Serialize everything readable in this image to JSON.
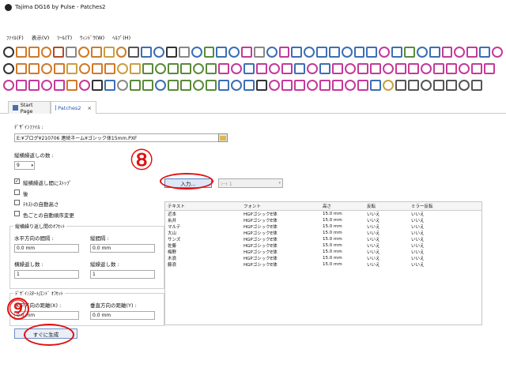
{
  "window": {
    "title": "Tajima DG16 by Pulse - Patches2"
  },
  "menu": [
    "ﾌｧｲﾙ(F)",
    "表示(V)",
    "ﾂｰﾙ(T)",
    "ｳｨﾝﾄﾞｳ(W)",
    "ﾍﾙﾌﾟ(H)"
  ],
  "tabs": [
    {
      "label": "Start Page"
    },
    {
      "label": "Patches2",
      "close": "×"
    }
  ],
  "form": {
    "design_file_label": "ﾃﾞｻﾞｲﾝﾌｧｲﾙ :",
    "design_file_path": "E:¥ブログ¥210706 連続ネーム¥ゴシック体15mm.PXF",
    "repeat_count_label": "縦横繰返しの数 :",
    "repeat_count_value": "9",
    "input_button": "入力...",
    "sheet_select": "ｼｰﾄ 1",
    "checkboxes": [
      {
        "label": "縦横繰返し間にｽﾄｯﾌﾟ",
        "checked": true,
        "mark": "✓"
      },
      {
        "label": "後",
        "checked": false,
        "mark": ""
      },
      {
        "label": "ﾃｷｽﾄの自動高さ",
        "checked": false,
        "mark": ""
      },
      {
        "label": "色ごとの自動順序変更",
        "checked": false,
        "mark": ""
      }
    ],
    "offset_group": {
      "title": "縦横繰り返し間のｵﾌｾｯﾄ",
      "h_spacing_label": "水平方向の間隔 :",
      "h_spacing_value": "0.0 mm",
      "v_spacing_label": "縦間隔 :",
      "v_spacing_value": "0.0 mm",
      "h_repeat_label": "横繰返し数 :",
      "h_repeat_value": "1",
      "v_repeat_label": "縦繰返し数 :",
      "v_repeat_value": "1"
    },
    "insert_group": {
      "title": "ﾃﾞｻﾞｲﾝｽﾀｰﾄ/ｴﾝﾄﾞ ｵﾌｾｯﾄ",
      "h_distance_label": "水平方向の距離(X) :",
      "h_distance_value": "0.0 mm",
      "v_distance_label": "垂直方向の距離(Y) :",
      "v_distance_value": "0.0 mm"
    },
    "generate_button": "すぐに生成"
  },
  "table": {
    "headers": [
      "テキスト",
      "フォント",
      "高さ",
      "反転",
      "ミラー反転"
    ],
    "rows": [
      [
        "近本",
        "HGPゴシックE体",
        "15.0 mm",
        "いいえ",
        "いいえ"
      ],
      [
        "糸井",
        "HGPゴシックE体",
        "15.0 mm",
        "いいえ",
        "いいえ"
      ],
      [
        "マルテ",
        "HGPゴシックE体",
        "15.0 mm",
        "いいえ",
        "いいえ"
      ],
      [
        "大山",
        "HGPゴシックE体",
        "15.0 mm",
        "いいえ",
        "いいえ"
      ],
      [
        "サンズ",
        "HGPゴシックE体",
        "15.0 mm",
        "いいえ",
        "いいえ"
      ],
      [
        "佐藤",
        "HGPゴシックE体",
        "15.0 mm",
        "いいえ",
        "いいえ"
      ],
      [
        "梅野",
        "HGPゴシックE体",
        "15.0 mm",
        "いいえ",
        "いいえ"
      ],
      [
        "木浪",
        "HGPゴシックE体",
        "15.0 mm",
        "いいえ",
        "いいえ"
      ],
      [
        "藤浪",
        "HGPゴシックE体",
        "15.0 mm",
        "いいえ",
        "いいえ"
      ]
    ]
  },
  "annotations": {
    "num8": "⑧",
    "num9": "⑨"
  },
  "colors": {
    "accent_red": "#e01010",
    "tab_blue": "#1d56b3"
  }
}
